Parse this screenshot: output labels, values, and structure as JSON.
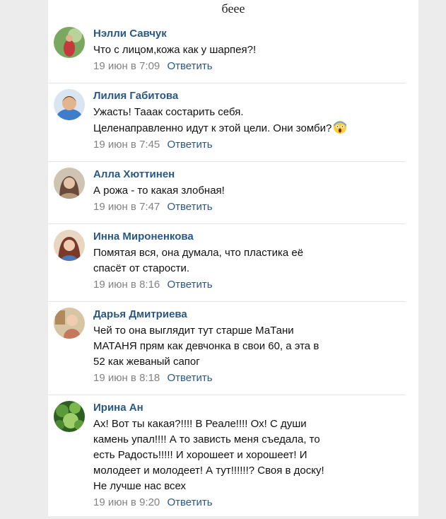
{
  "header_text": "беее",
  "reply_label": "Ответить",
  "comments": [
    {
      "author": "Нэлли Савчук",
      "text": "Что с лицом,кожа как у шарпея?!",
      "time": "19 июн в 7:09",
      "avatar_colors": [
        "#7aa860",
        "#c23a3a"
      ]
    },
    {
      "author": "Лилия Габитова",
      "text": "Ужасть! Тааак состарить себя.\nЦеленаправленно идут к этой цели. Они зомби?",
      "emoji": "scream-emoji",
      "time": "19 июн в 7:45",
      "avatar_colors": [
        "#3d7dc9",
        "#e3b58e"
      ]
    },
    {
      "author": "Алла Хюттинен",
      "text": "А рожа - то какая злобная!",
      "time": "19 июн в 7:47",
      "avatar_colors": [
        "#b59a7a",
        "#6a4a3a"
      ]
    },
    {
      "author": "Инна Мироненкова",
      "text": "Помятая вся, она думала, что пластика её\nспасёт от старости.",
      "time": "19 июн в 8:16",
      "avatar_colors": [
        "#c98a6a",
        "#7a3a2a"
      ]
    },
    {
      "author": "Дарья Дмитриева",
      "text": "Чей то она выглядит тут старше МаТани\nМАТАНЯ прям как девчонка в свои 60, а эта в\n52 как жеваный сапог",
      "time": "19 июн в 8:18",
      "avatar_colors": [
        "#d7c6a4",
        "#8a6a4a"
      ]
    },
    {
      "author": "Ирина Ан",
      "text": "Ах! Вот ты какая?!!!! В Реале!!!! Ох! С души\nкамень упал!!!! А то зависть меня съедала, то\nесть Радость!!!!! И хорошеет и хорошеет! И\nмолодеет и молодеет! А тут!!!!!!? Своя в доску!\nНе лучше нас всех",
      "time": "19 июн в 9:20",
      "avatar_colors": [
        "#3f7a2e",
        "#9fce6a"
      ]
    }
  ]
}
